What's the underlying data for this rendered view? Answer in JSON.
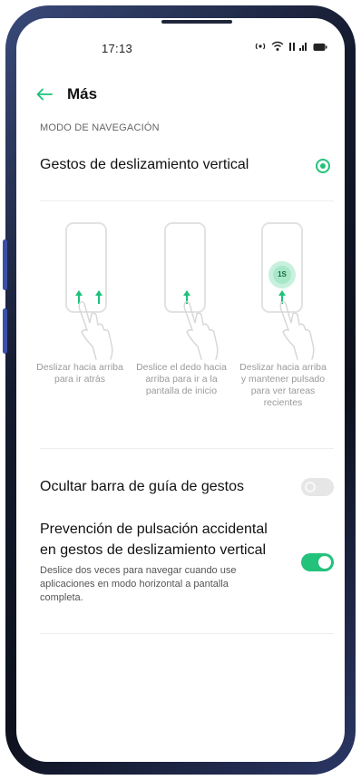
{
  "status_bar": {
    "time": "17:13",
    "icons": [
      "hotspot-icon",
      "wifi-icon",
      "signal-icon",
      "battery-icon"
    ]
  },
  "header": {
    "back_icon": "back-arrow-icon",
    "title": "Más"
  },
  "section_title": "MODO DE NAVEGACIÓN",
  "navigation_option": {
    "label": "Gestos de deslizamiento vertical",
    "selected": true
  },
  "gestures": [
    {
      "label": "Deslizar hacia arriba para ir atrás"
    },
    {
      "label": "Deslice el dedo hacia arriba para ir a la pantalla de inicio"
    },
    {
      "label": "Deslizar hacia arriba y mantener pulsado para ver tareas recientes",
      "badge": "1S"
    }
  ],
  "hide_bar": {
    "label": "Ocultar barra de guía de gestos",
    "enabled": false
  },
  "accidental": {
    "label": "Prevención de pulsación accidental en gestos de deslizamiento vertical",
    "description": "Deslice dos veces para navegar cuando use aplicaciones en modo horizontal a pantalla completa.",
    "enabled": true
  },
  "colors": {
    "accent": "#23c27b",
    "frame": "#141a2e"
  }
}
